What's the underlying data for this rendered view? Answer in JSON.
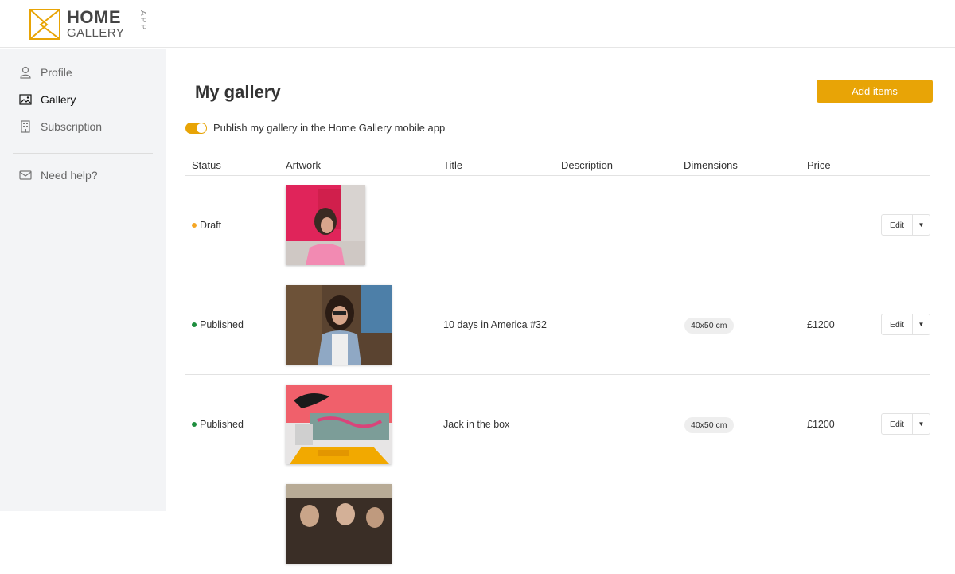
{
  "brand": {
    "home": "HOME",
    "gallery": "GALLERY",
    "app": "APP",
    "accent": "#e8a406"
  },
  "sidebar": {
    "items": [
      {
        "label": "Profile",
        "icon": "user-icon"
      },
      {
        "label": "Gallery",
        "icon": "image-icon"
      },
      {
        "label": "Subscription",
        "icon": "building-icon"
      }
    ],
    "help": {
      "label": "Need help?",
      "icon": "envelope-icon"
    }
  },
  "main": {
    "title": "My gallery",
    "add_button": "Add items",
    "publish_toggle": {
      "label": "Publish my gallery in the Home Gallery mobile app",
      "on": true
    }
  },
  "table": {
    "headers": [
      "Status",
      "Artwork",
      "Title",
      "Description",
      "Dimensions",
      "Price"
    ],
    "rows": [
      {
        "status": "Draft",
        "status_color": "#f5a623",
        "artwork": "photo-pink-woman",
        "title": "",
        "description": "",
        "dimensions": "",
        "price": "",
        "edit": "Edit"
      },
      {
        "status": "Published",
        "status_color": "#1e8e3e",
        "artwork": "photo-woman-sunglasses",
        "title": "10 days in America #32",
        "description": "",
        "dimensions": "40x50 cm",
        "price": "£1200",
        "edit": "Edit"
      },
      {
        "status": "Published",
        "status_color": "#1e8e3e",
        "artwork": "photo-taxi-graffiti",
        "title": "Jack in the box",
        "description": "",
        "dimensions": "40x50 cm",
        "price": "£1200",
        "edit": "Edit"
      },
      {
        "status": "",
        "artwork": "photo-crowd"
      }
    ]
  }
}
